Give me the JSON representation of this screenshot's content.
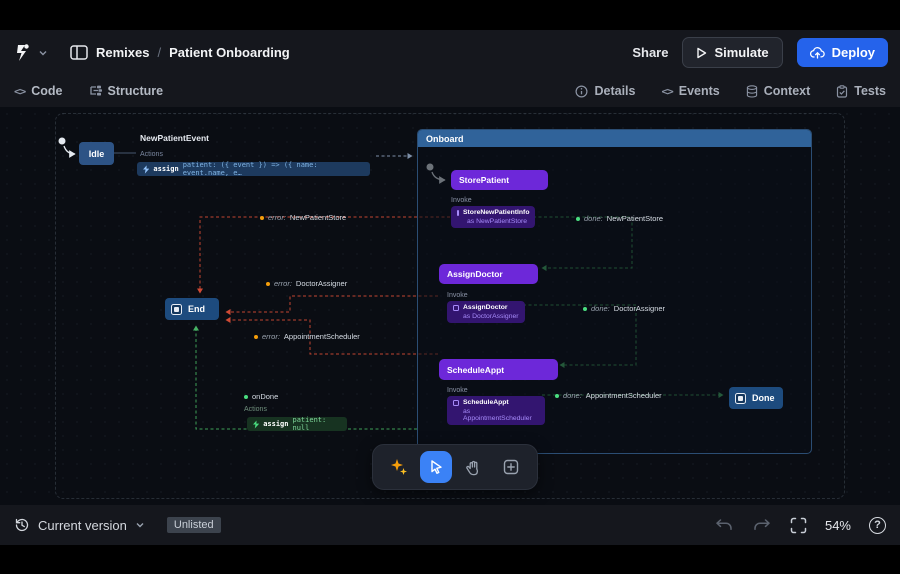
{
  "header": {
    "breadcrumb": {
      "panel": "Remixes",
      "separator": "/",
      "title": "Patient Onboarding"
    },
    "share": "Share",
    "simulate": "Simulate",
    "deploy": "Deploy"
  },
  "modebar": {
    "code": "Code",
    "structure": "Structure",
    "details": "Details",
    "events": "Events",
    "context": "Context",
    "tests": "Tests"
  },
  "icons": {
    "code": "<>",
    "events": "<>",
    "help": "?"
  },
  "machine": {
    "initial_event": {
      "name": "NewPatientEvent",
      "actions_label": "Actions",
      "action_keyword": "assign",
      "action_code": "patient: ({ event }) => ({ name: event.name, e…"
    },
    "states": {
      "idle": "Idle",
      "onboard": "Onboard",
      "end": "End",
      "done": "Done",
      "store_patient": {
        "name": "StorePatient",
        "invoke_label": "Invoke",
        "src": "StoreNewPatientInfo",
        "as": "as NewPatientStore"
      },
      "assign_doctor": {
        "name": "AssignDoctor",
        "invoke_label": "Invoke",
        "src": "AssignDoctor",
        "as": "as DoctorAssigner"
      },
      "schedule_appt": {
        "name": "ScheduleAppt",
        "invoke_label": "Invoke",
        "src": "ScheduleAppt",
        "as": "as AppointmentScheduler"
      }
    },
    "transitions": {
      "done_store": {
        "kind": "done:",
        "target": "NewPatientStore"
      },
      "done_doctor": {
        "kind": "done:",
        "target": "DoctorAssigner"
      },
      "done_schedule": {
        "kind": "done:",
        "target": "AppointmentScheduler"
      },
      "error_store": {
        "kind": "error:",
        "target": "NewPatientStore"
      },
      "error_doctor": {
        "kind": "error:",
        "target": "DoctorAssigner"
      },
      "error_schedule": {
        "kind": "error:",
        "target": "AppointmentScheduler"
      },
      "on_done": {
        "name": "onDone",
        "actions_label": "Actions",
        "action_keyword": "assign",
        "action_code": "patient: null"
      }
    }
  },
  "footer": {
    "version": "Current version",
    "badge": "Unlisted",
    "zoom": "54%"
  },
  "colors": {
    "accent_blue": "#2563eb",
    "state_purple": "#6d28d9",
    "state_blue": "#2d5385",
    "onboard_header": "#30639a",
    "error_red": "#c24532",
    "done_green": "#3d9e57",
    "canvas_bg": "#0a0d13"
  }
}
